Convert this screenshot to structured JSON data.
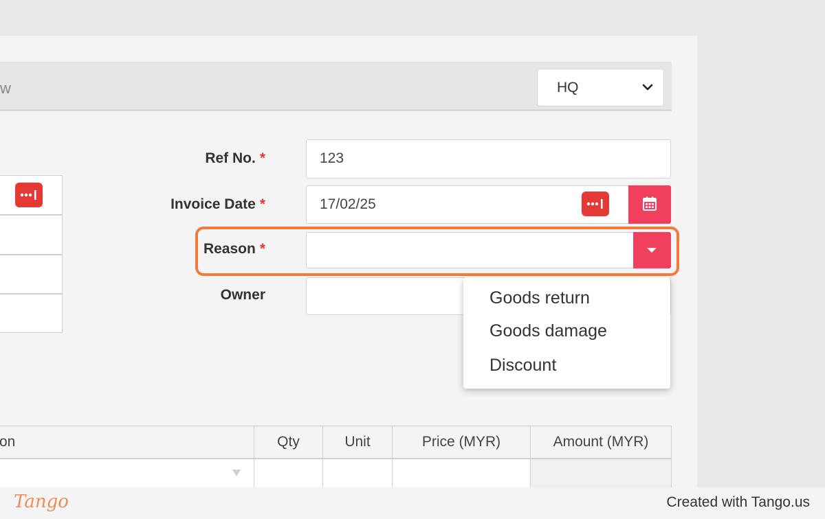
{
  "header": {
    "partial_text": "w",
    "branch_select_value": "HQ"
  },
  "form": {
    "ref_no": {
      "label": "Ref No.",
      "required_mark": "*",
      "value": "123"
    },
    "invoice_date": {
      "label": "Invoice Date",
      "required_mark": "*",
      "value": "17/02/25"
    },
    "reason": {
      "label": "Reason",
      "required_mark": "*",
      "value": ""
    },
    "owner": {
      "label": "Owner",
      "value": ""
    }
  },
  "reason_dropdown": {
    "options": [
      "Goods return",
      "Goods damage",
      "Discount"
    ]
  },
  "table": {
    "headers": [
      "on",
      "Qty",
      "Unit",
      "Price (MYR)",
      "Amount (MYR)"
    ]
  },
  "footer": {
    "logo": "Tango",
    "credit": "Created with Tango.us"
  },
  "colors": {
    "accent_pink": "#f0405e",
    "accent_red": "#e53935",
    "highlight_orange": "#f47a3e"
  }
}
